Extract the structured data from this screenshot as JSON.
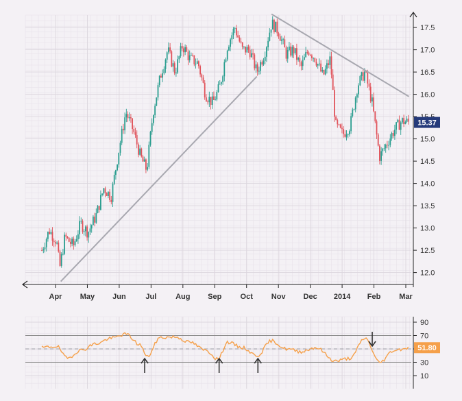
{
  "colors": {
    "background": "#f4f1f5",
    "grid_minor": "#e8e2ea",
    "grid_major": "#dcd6de",
    "up_candle": "#2a9d8f",
    "down_candle": "#e0525a",
    "trendline": "#a8a8b0",
    "rsi_line": "#f5a04a",
    "rsi_band": "#888888",
    "price_badge": "#253a7a",
    "rsi_badge": "#f5a04a",
    "arrow": "#333333"
  },
  "chart_data": [
    {
      "type": "candlestick",
      "title": "",
      "xlabel": "",
      "ylabel": "",
      "x_ticks": [
        "Apr",
        "May",
        "Jun",
        "Jul",
        "Aug",
        "Sep",
        "Oct",
        "Nov",
        "Dec",
        "2014",
        "Feb",
        "Mar"
      ],
      "y_ticks": [
        "12.0",
        "12.5",
        "13.0",
        "13.5",
        "14.0",
        "14.5",
        "15.0",
        "15.5",
        "16.0",
        "16.5",
        "17.0",
        "17.5"
      ],
      "ylim": [
        11.8,
        17.9
      ],
      "grid": true,
      "last_price_label": "15.37",
      "close_path": [
        [
          "2013-03-19",
          12.5
        ],
        [
          "2013-03-26",
          12.95
        ],
        [
          "2013-04-02",
          12.7
        ],
        [
          "2013-04-05",
          12.1
        ],
        [
          "2013-04-10",
          12.8
        ],
        [
          "2013-04-18",
          12.6
        ],
        [
          "2013-04-25",
          13.1
        ],
        [
          "2013-05-02",
          12.9
        ],
        [
          "2013-05-10",
          13.3
        ],
        [
          "2013-05-17",
          13.9
        ],
        [
          "2013-05-24",
          13.7
        ],
        [
          "2013-05-31",
          14.7
        ],
        [
          "2013-06-07",
          15.6
        ],
        [
          "2013-06-14",
          15.2
        ],
        [
          "2013-06-21",
          14.6
        ],
        [
          "2013-06-27",
          14.3
        ],
        [
          "2013-07-03",
          15.6
        ],
        [
          "2013-07-10",
          16.4
        ],
        [
          "2013-07-17",
          17.0
        ],
        [
          "2013-07-24",
          16.5
        ],
        [
          "2013-07-31",
          17.1
        ],
        [
          "2013-08-07",
          16.8
        ],
        [
          "2013-08-15",
          16.7
        ],
        [
          "2013-08-22",
          16.0
        ],
        [
          "2013-08-29",
          15.8
        ],
        [
          "2013-09-05",
          16.2
        ],
        [
          "2013-09-12",
          17.1
        ],
        [
          "2013-09-19",
          17.5
        ],
        [
          "2013-09-26",
          17.0
        ],
        [
          "2013-10-03",
          17.0
        ],
        [
          "2013-10-10",
          16.5
        ],
        [
          "2013-10-17",
          16.9
        ],
        [
          "2013-10-24",
          17.6
        ],
        [
          "2013-10-31",
          17.4
        ],
        [
          "2013-11-07",
          16.9
        ],
        [
          "2013-11-14",
          17.0
        ],
        [
          "2013-11-21",
          16.6
        ],
        [
          "2013-11-28",
          17.0
        ],
        [
          "2013-12-05",
          16.8
        ],
        [
          "2013-12-12",
          16.4
        ],
        [
          "2013-12-19",
          16.8
        ],
        [
          "2013-12-24",
          15.3
        ],
        [
          "2013-12-31",
          15.1
        ],
        [
          "2014-01-07",
          15.3
        ],
        [
          "2014-01-14",
          16.2
        ],
        [
          "2014-01-21",
          16.5
        ],
        [
          "2014-01-28",
          15.8
        ],
        [
          "2014-02-04",
          14.6
        ],
        [
          "2014-02-11",
          14.9
        ],
        [
          "2014-02-18",
          15.2
        ],
        [
          "2014-02-25",
          15.4
        ],
        [
          "2014-03-04",
          15.37
        ]
      ],
      "trendlines": [
        {
          "from": [
            "2013-04-06",
            11.8
          ],
          "to": [
            "2013-10-10",
            16.4
          ]
        },
        {
          "from": [
            "2013-10-24",
            17.8
          ],
          "to": [
            "2014-03-04",
            15.95
          ]
        }
      ]
    },
    {
      "type": "line",
      "title": "",
      "xlabel": "",
      "ylabel": "",
      "y_ticks": [
        "10",
        "30",
        "50",
        "70",
        "90"
      ],
      "ylim": [
        0,
        100
      ],
      "bands": [
        30,
        70
      ],
      "midline": 50,
      "last_value_label": "51.80",
      "rsi_path": [
        [
          "2013-03-19",
          52
        ],
        [
          "2013-04-02",
          54
        ],
        [
          "2013-04-12",
          36
        ],
        [
          "2013-04-25",
          48
        ],
        [
          "2013-05-10",
          58
        ],
        [
          "2013-05-24",
          66
        ],
        [
          "2013-06-07",
          72
        ],
        [
          "2013-06-21",
          56
        ],
        [
          "2013-06-27",
          38
        ],
        [
          "2013-07-10",
          67
        ],
        [
          "2013-07-24",
          68
        ],
        [
          "2013-08-07",
          60
        ],
        [
          "2013-08-22",
          48
        ],
        [
          "2013-09-03",
          35
        ],
        [
          "2013-09-12",
          60
        ],
        [
          "2013-09-26",
          52
        ],
        [
          "2013-10-10",
          40
        ],
        [
          "2013-10-24",
          62
        ],
        [
          "2013-11-07",
          50
        ],
        [
          "2013-11-21",
          46
        ],
        [
          "2013-12-05",
          52
        ],
        [
          "2013-12-24",
          32
        ],
        [
          "2014-01-07",
          36
        ],
        [
          "2014-01-21",
          66
        ],
        [
          "2014-02-04",
          30
        ],
        [
          "2014-02-18",
          48
        ],
        [
          "2014-03-04",
          51.8
        ]
      ],
      "signal_arrows": [
        {
          "date": "2013-06-25",
          "direction": "up"
        },
        {
          "date": "2013-09-04",
          "direction": "up"
        },
        {
          "date": "2013-10-11",
          "direction": "up"
        },
        {
          "date": "2014-01-28",
          "direction": "down"
        }
      ]
    }
  ]
}
